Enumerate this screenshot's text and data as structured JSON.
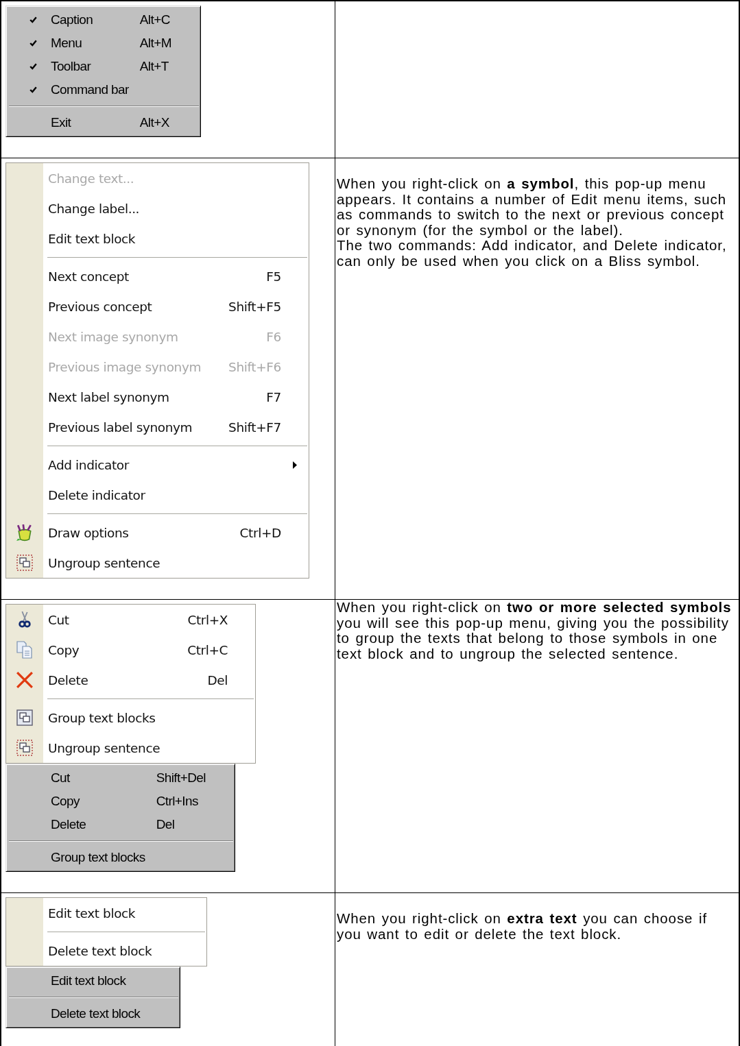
{
  "table": {
    "rows": [
      {
        "menus": [
          {
            "kind": "classic",
            "items": [
              {
                "kind": "item",
                "label": "Caption",
                "shortcut": "Alt+C",
                "checked": true
              },
              {
                "kind": "item",
                "label": "Menu",
                "shortcut": "Alt+M",
                "checked": true
              },
              {
                "kind": "item",
                "label": "Toolbar",
                "shortcut": "Alt+T",
                "checked": true
              },
              {
                "kind": "item",
                "label": "Command bar",
                "checked": true
              },
              {
                "kind": "separator"
              },
              {
                "kind": "item",
                "label": "Exit",
                "shortcut": "Alt+X",
                "checked": false
              }
            ]
          }
        ]
      },
      {
        "menus": [
          {
            "kind": "xp",
            "items": [
              {
                "kind": "item",
                "label": "Change text...",
                "disabled": true,
                "submenu": false
              },
              {
                "kind": "item",
                "label": "Change label...",
                "disabled": false,
                "submenu": false
              },
              {
                "kind": "item",
                "label": "Edit text block",
                "disabled": false,
                "submenu": false
              },
              {
                "kind": "separator"
              },
              {
                "kind": "item",
                "label": "Next concept",
                "shortcut": "F5",
                "disabled": false,
                "submenu": false
              },
              {
                "kind": "item",
                "label": "Previous concept",
                "shortcut": "Shift+F5",
                "disabled": false,
                "submenu": false
              },
              {
                "kind": "item",
                "label": "Next image synonym",
                "shortcut": "F6",
                "disabled": true,
                "submenu": false
              },
              {
                "kind": "item",
                "label": "Previous image synonym",
                "shortcut": "Shift+F6",
                "disabled": true,
                "submenu": false
              },
              {
                "kind": "item",
                "label": "Next label synonym",
                "shortcut": "F7",
                "disabled": false,
                "submenu": false
              },
              {
                "kind": "item",
                "label": "Previous label synonym",
                "shortcut": "Shift+F7",
                "disabled": false,
                "submenu": false
              },
              {
                "kind": "separator"
              },
              {
                "kind": "item",
                "label": "Add indicator",
                "disabled": false,
                "submenu": true
              },
              {
                "kind": "item",
                "label": "Delete indicator",
                "disabled": false,
                "submenu": false
              },
              {
                "kind": "separator"
              },
              {
                "kind": "paint",
                "label": "Draw options",
                "shortcut": "Ctrl+D",
                "disabled": false,
                "submenu": false
              },
              {
                "kind": "ungroup",
                "label": "Ungroup sentence",
                "disabled": false,
                "submenu": false
              }
            ]
          }
        ],
        "paragraphs": [
          "When you right-click on **a symbol**, this pop-up menu appears. It contains a number of Edit menu items, such as commands to switch to the next or previous concept or synonym (for the symbol or the label).",
          "The two commands: Add indicator, and Delete indicator, can only be used when you click on a Bliss symbol."
        ]
      },
      {
        "menus": [
          {
            "kind": "xp",
            "items": [
              {
                "kind": "scissors",
                "label": "Cut",
                "shortcut": "Ctrl+X"
              },
              {
                "kind": "copy",
                "label": "Copy",
                "shortcut": "Ctrl+C"
              },
              {
                "kind": "delete",
                "label": "Delete",
                "shortcut": "Del"
              },
              {
                "kind": "separator"
              },
              {
                "kind": "group",
                "label": "Group text blocks"
              },
              {
                "kind": "ungroup",
                "label": "Ungroup sentence"
              }
            ]
          },
          {
            "kind": "classic",
            "items": [
              {
                "kind": "item",
                "label": "Cut",
                "shortcut": "Shift+Del"
              },
              {
                "kind": "item",
                "label": "Copy",
                "shortcut": "Ctrl+Ins"
              },
              {
                "kind": "item",
                "label": "Delete",
                "shortcut": "Del"
              },
              {
                "kind": "separator"
              },
              {
                "kind": "item",
                "label": "Group text blocks"
              }
            ]
          }
        ],
        "paragraphs": [
          "When you right-click on **two or more selected symbols** you will see this pop-up menu, giving you the possibility to group the texts that belong to those symbols in one text block and to ungroup the selected sentence."
        ]
      },
      {
        "menus": [
          {
            "kind": "xp",
            "items": [
              {
                "kind": "item",
                "label": "Edit text block"
              },
              {
                "kind": "separator"
              },
              {
                "kind": "item",
                "label": "Delete text block"
              }
            ]
          },
          {
            "kind": "classic",
            "items": [
              {
                "kind": "item",
                "label": "Edit text block"
              },
              {
                "kind": "separator"
              },
              {
                "kind": "item",
                "label": "Delete text block"
              }
            ]
          }
        ],
        "paragraphs": [
          "When you right-click on **extra text** you can choose if you want to edit or delete the text block."
        ]
      }
    ]
  }
}
